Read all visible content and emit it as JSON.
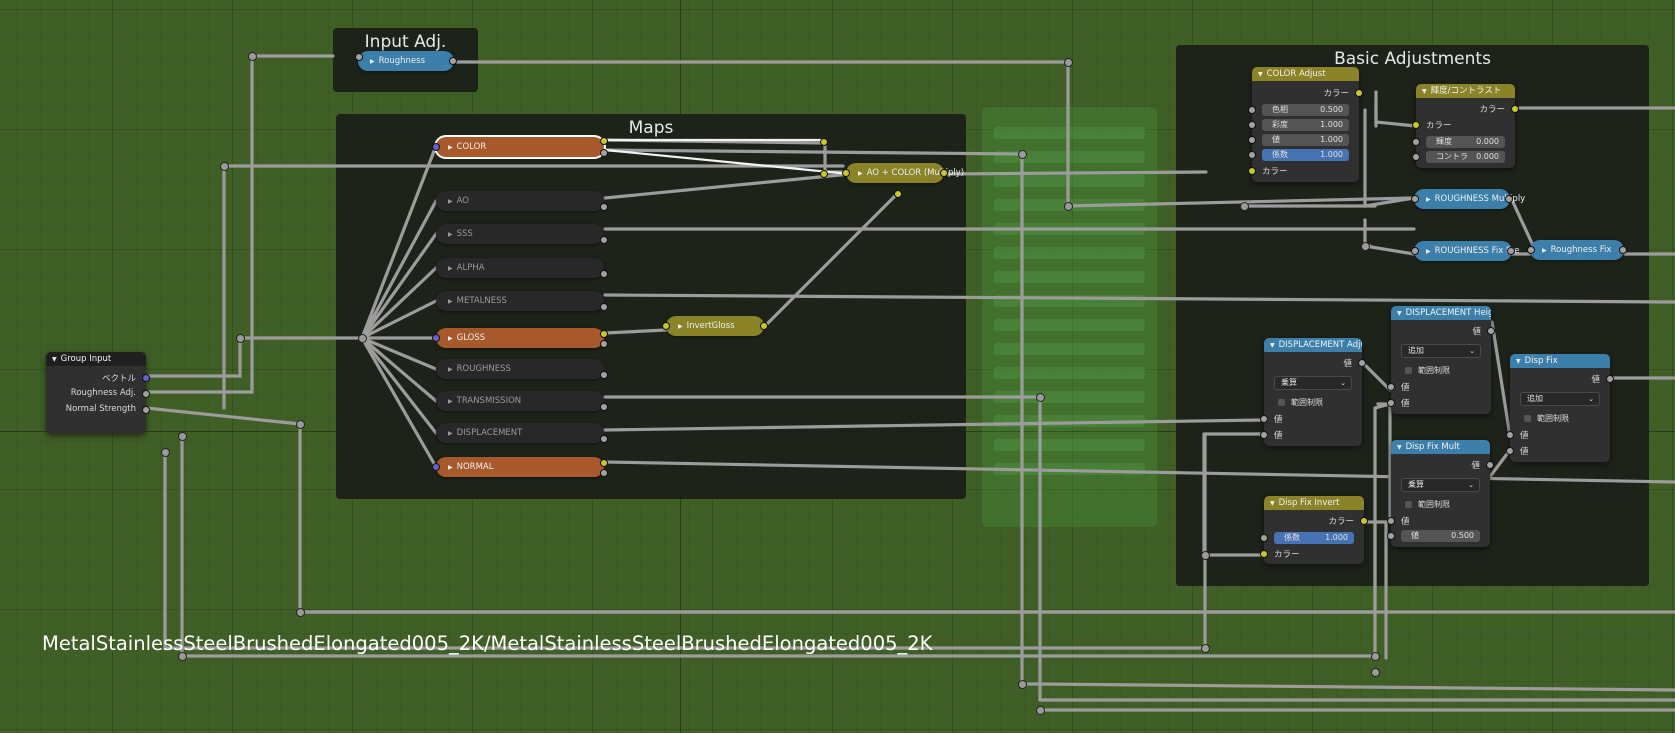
{
  "frames": {
    "input_adj": {
      "label": "Input Adj."
    },
    "maps": {
      "label": "Maps"
    },
    "basic_adjustments": {
      "label": "Basic Adjustments"
    }
  },
  "group_input": {
    "title": "Group Input",
    "outputs": [
      "ベクトル",
      "Roughness Adj.",
      "Normal Strength"
    ]
  },
  "input_adj_node": {
    "label": "Roughness"
  },
  "maps": [
    {
      "label": "COLOR",
      "style": "orange"
    },
    {
      "label": "AO",
      "style": "dark"
    },
    {
      "label": "SSS",
      "style": "dark"
    },
    {
      "label": "ALPHA",
      "style": "dark"
    },
    {
      "label": "METALNESS",
      "style": "dark"
    },
    {
      "label": "GLOSS",
      "style": "orange"
    },
    {
      "label": "ROUGHNESS",
      "style": "dark"
    },
    {
      "label": "TRANSMISSION",
      "style": "dark"
    },
    {
      "label": "DISPLACEMENT",
      "style": "dark"
    },
    {
      "label": "NORMAL",
      "style": "orange"
    }
  ],
  "mix_node": {
    "label": "AO + COLOR (Multiply)"
  },
  "invert_node": {
    "label": "InvertGloss"
  },
  "color_adjust": {
    "title": "COLOR Adjust",
    "output": "カラー",
    "fields": [
      {
        "label": "色相",
        "value": "0.500"
      },
      {
        "label": "彩度",
        "value": "1.000"
      },
      {
        "label": "値",
        "value": "1.000"
      },
      {
        "label": "係数",
        "value": "1.000"
      }
    ],
    "input": "カラー"
  },
  "brightness_contrast": {
    "title": "輝度/コントラスト",
    "output": "カラー",
    "input": "カラー",
    "fields": [
      {
        "label": "輝度",
        "value": "0.000"
      },
      {
        "label": "コントラ",
        "value": "0.000"
      }
    ]
  },
  "roughness_multiply": {
    "label": "ROUGHNESS Multiply"
  },
  "roughness_fix_pre": {
    "label": "ROUGHNESS Fix Pre"
  },
  "roughness_fix": {
    "label": "Roughness Fix"
  },
  "displacement_adjust": {
    "title": "DISPLACEMENT Adjust",
    "output": "値",
    "select": "乗算",
    "clamp": "範囲制限",
    "inputs": [
      "値",
      "値"
    ]
  },
  "displacement_height": {
    "title": "DISPLACEMENT Height",
    "output": "値",
    "select": "追加",
    "clamp": "範囲制限",
    "inputs": [
      "値",
      "値"
    ]
  },
  "disp_fix": {
    "title": "Disp Fix",
    "output": "値",
    "select": "追加",
    "clamp": "範囲制限",
    "inputs": [
      "値",
      "値"
    ]
  },
  "disp_fix_mult": {
    "title": "Disp Fix Mult",
    "output": "値",
    "select": "乗算",
    "clamp": "範囲制限",
    "input": "値",
    "field": {
      "label": "値",
      "value": "0.500"
    }
  },
  "disp_fix_invert": {
    "title": "Disp Fix Invert",
    "output": "カラー",
    "field": {
      "label": "係数",
      "value": "1.000"
    },
    "input": "カラー"
  },
  "material_path": "MetalStainlessSteelBrushedElongated005_2K/MetalStainlessSteelBrushedElongated005_2K",
  "colors": {
    "background": "#3f5f26",
    "frame": "#1c1e1a",
    "orange": "#a8592b",
    "olive": "#8a8327",
    "blue": "#3d7fab",
    "link": "#9c9c9c",
    "socket_yellow": "#c7c729",
    "socket_purple": "#6363c7"
  }
}
